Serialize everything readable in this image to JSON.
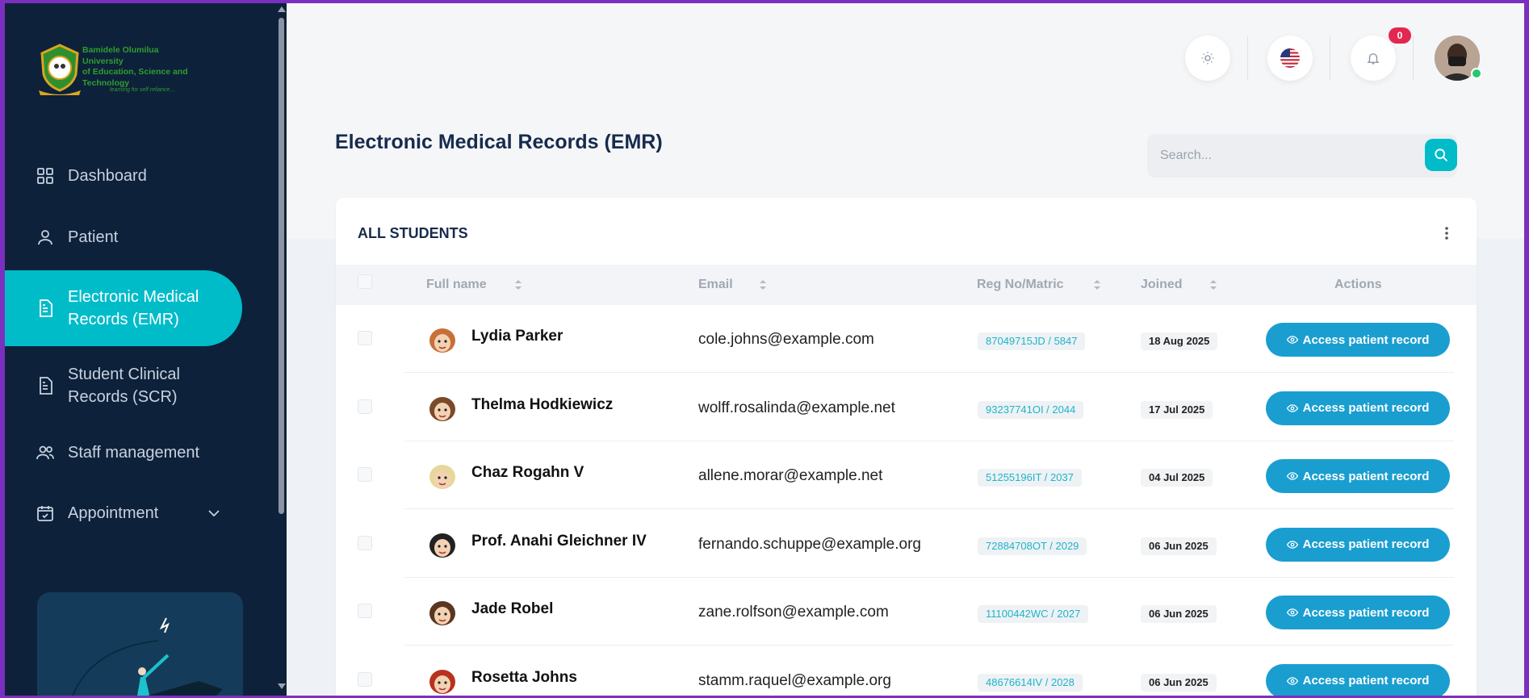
{
  "sidebar": {
    "logo": {
      "line1": "Bamidele Olumilua University",
      "line2": "of Education, Science and",
      "line3": "Technology",
      "tagline": "learning for self reliance..."
    },
    "items": [
      {
        "label": "Dashboard",
        "icon": "grid-icon"
      },
      {
        "label": "Patient",
        "icon": "user-icon"
      },
      {
        "label_line1": "Electronic Medical",
        "label_line2": "Records (EMR)",
        "icon": "document-icon",
        "active": true
      },
      {
        "label_line1": "Student Clinical",
        "label_line2": "Records (SCR)",
        "icon": "document-icon"
      },
      {
        "label": "Staff management",
        "icon": "users-icon"
      },
      {
        "label": "Appointment",
        "icon": "calendar-icon"
      }
    ]
  },
  "header": {
    "notifications_count": "0"
  },
  "page": {
    "title": "Electronic Medical Records (EMR)",
    "search_placeholder": "Search..."
  },
  "table": {
    "title": "ALL STUDENTS",
    "columns": {
      "full_name": "Full name",
      "email": "Email",
      "reg": "Reg No/Matric",
      "joined": "Joined",
      "actions": "Actions"
    },
    "action_label": "Access patient record",
    "rows": [
      {
        "name": "Lydia Parker",
        "email": "cole.johns@example.com",
        "reg": "87049715JD / 5847",
        "joined": "18 Aug 2025",
        "avatar_color": "#c8703a"
      },
      {
        "name": "Thelma Hodkiewicz",
        "email": "wolff.rosalinda@example.net",
        "reg": "93237741OI / 2044",
        "joined": "17 Jul 2025",
        "avatar_color": "#7a4a2a"
      },
      {
        "name": "Chaz Rogahn V",
        "email": "allene.morar@example.net",
        "reg": "51255196IT / 2037",
        "joined": "04 Jul 2025",
        "avatar_color": "#e8d79a"
      },
      {
        "name": "Prof. Anahi Gleichner IV",
        "email": "fernando.schuppe@example.org",
        "reg": "72884708OT / 2029",
        "joined": "06 Jun 2025",
        "avatar_color": "#222222"
      },
      {
        "name": "Jade Robel",
        "email": "zane.rolfson@example.com",
        "reg": "11100442WC / 2027",
        "joined": "06 Jun 2025",
        "avatar_color": "#5a3520"
      },
      {
        "name": "Rosetta Johns",
        "email": "stamm.raquel@example.org",
        "reg": "48676614IV / 2028",
        "joined": "06 Jun 2025",
        "avatar_color": "#b8321e"
      }
    ]
  }
}
